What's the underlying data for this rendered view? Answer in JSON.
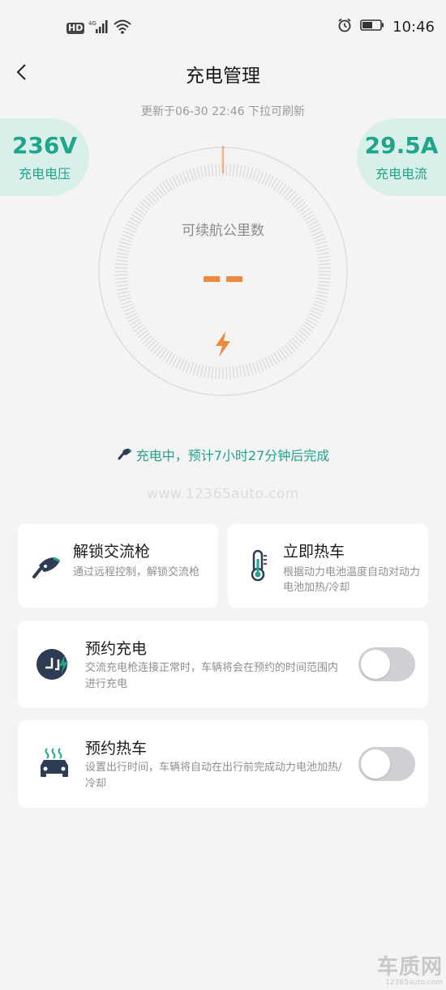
{
  "status_bar": {
    "network_hd": "HD",
    "network_4g": "4G",
    "time": "10:46"
  },
  "header": {
    "title": "充电管理"
  },
  "update_text": "更新于06-30 22:46   下拉可刷新",
  "voltage": {
    "value": "236V",
    "label": "充电电压"
  },
  "current": {
    "value": "29.5A",
    "label": "充电电流"
  },
  "gauge": {
    "label": "可续航公里数",
    "value": "--",
    "accent_color": "#ef8a3c"
  },
  "charge_status": "充电中，预计7小时27分钟后完成",
  "watermark": "www.12365auto.com",
  "cards": {
    "unlock": {
      "title": "解锁交流枪",
      "desc": "通过远程控制，解锁交流枪"
    },
    "preheat_now": {
      "title": "立即热车",
      "desc": "根据动力电池温度自动对动力电池加热/冷却"
    },
    "schedule_charge": {
      "title": "预约充电",
      "desc": "交流充电枪连接正常时，车辆将会在预约的时间范围内进行充电",
      "enabled": false
    },
    "schedule_heat": {
      "title": "预约热车",
      "desc": "设置出行时间，车辆将自动在出行前完成动力电池加热/冷却",
      "enabled": false
    }
  },
  "logo": {
    "main": "车质网",
    "sub": "12365auto.com"
  },
  "colors": {
    "accent_green": "#1fa58c",
    "pill_bg": "#d9efe9",
    "orange": "#ef8a3c"
  }
}
